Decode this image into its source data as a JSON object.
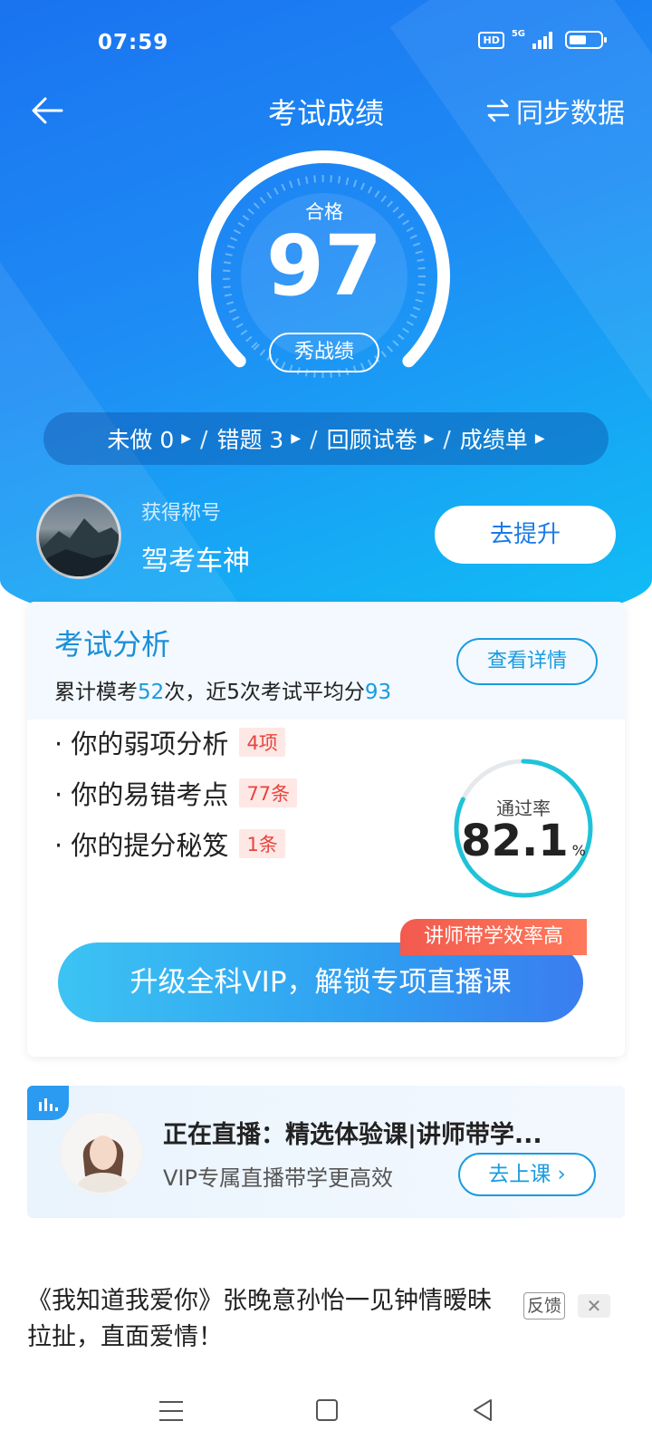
{
  "status_bar": {
    "time": "07:59",
    "hd": "HD",
    "network": "5G"
  },
  "header": {
    "title": "考试成绩",
    "sync_label": "同步数据"
  },
  "score": {
    "status": "合格",
    "value": "97",
    "show_label": "秀战绩"
  },
  "links": [
    {
      "label": "未做 0"
    },
    {
      "label": "错题  3"
    },
    {
      "label": "回顾试卷"
    },
    {
      "label": "成绩单"
    }
  ],
  "user": {
    "title_label": "获得称号",
    "title_value": "驾考车神",
    "improve_label": "去提升"
  },
  "analysis": {
    "title": "考试分析",
    "sub_prefix": "累计模考",
    "exam_count": "52",
    "sub_middle": "次，近5次考试平均分",
    "avg_score": "93",
    "detail_label": "查看详情",
    "items": [
      {
        "label": "· 你的弱项分析",
        "badge": "4项"
      },
      {
        "label": "· 你的易错考点",
        "badge": "77条"
      },
      {
        "label": "· 你的提分秘笈",
        "badge": "1条"
      }
    ],
    "pass_rate_label": "通过率",
    "pass_rate": "82.1",
    "pass_rate_unit": "%",
    "pass_rate_value": 82.1,
    "vip_tag": "讲师带学效率高",
    "vip_label": "升级全科VIP，解锁专项直播课"
  },
  "live": {
    "title": "正在直播：精选体验课|讲师带学...",
    "subtitle": "VIP专属直播带学更高效",
    "button_label": "去上课"
  },
  "ad": {
    "text": "《我知道我爱你》张晚意孙怡一见钟情暧昧拉扯，直面爱情！",
    "feedback_label": "反馈",
    "close_label": "✕"
  },
  "colors": {
    "primary": "#1a8fe8",
    "accent": "#1a9be0",
    "badge_red": "#e8453c"
  }
}
